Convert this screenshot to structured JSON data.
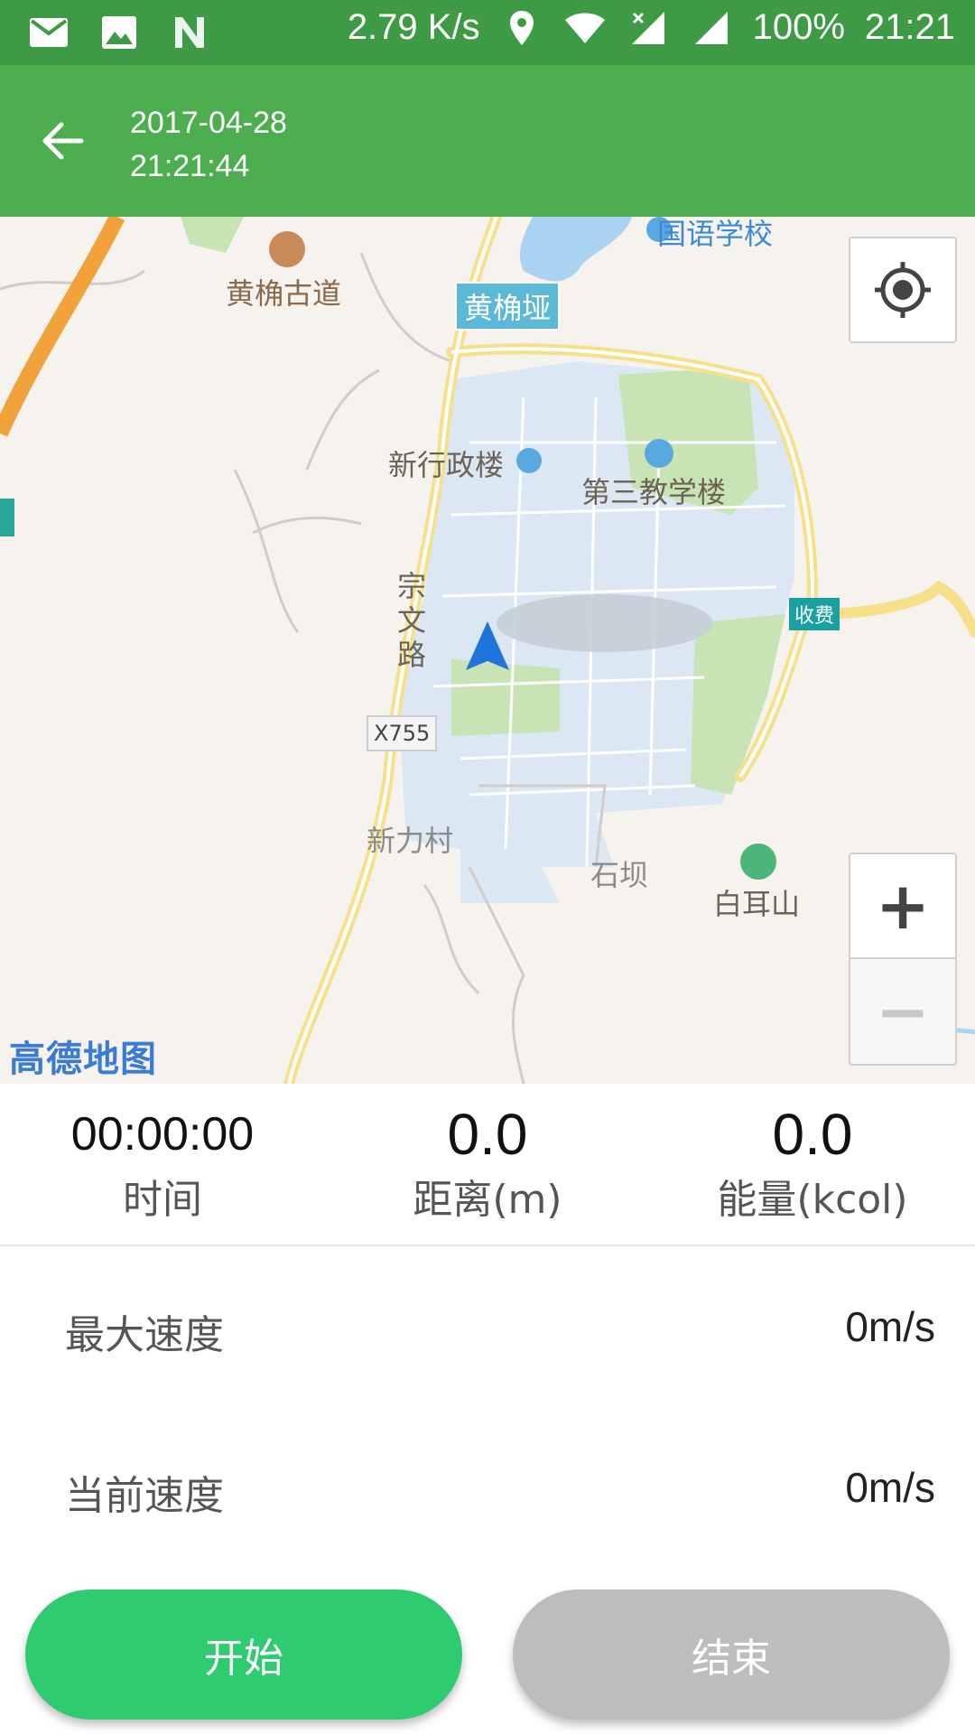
{
  "status_bar": {
    "net_speed": "2.79 K/s",
    "battery": "100%",
    "time": "21:21",
    "icons": [
      "mail-icon",
      "image-icon",
      "n-icon",
      "location-icon",
      "wifi-icon",
      "cellular-x-icon",
      "signal-icon"
    ]
  },
  "app_bar": {
    "date": "2017-04-28",
    "time": "21:21:44"
  },
  "map": {
    "labels": {
      "guoyu": "国语学校",
      "huangjiao_gudao": "黄桷古道",
      "huangjiaoya": "黄桷垭",
      "xinxingzheng": "新行政楼",
      "disan": "第三教学楼",
      "zongwen": "宗文路",
      "shoufei": "收费",
      "x755": "X755",
      "xinlicun": "新力村",
      "shiba": "石坝",
      "baier": "白耳山"
    },
    "logo": "高德地图",
    "zoom_in": "+",
    "zoom_out": "−"
  },
  "stats": {
    "time_value": "00:00:00",
    "time_label": "时间",
    "distance_value": "0.0",
    "distance_label": "距离(m)",
    "energy_value": "0.0",
    "energy_label": "能量(kcol)"
  },
  "max_speed": {
    "label": "最大速度",
    "value": "0m/s"
  },
  "current_speed": {
    "label": "当前速度",
    "value": "0m/s"
  },
  "buttons": {
    "start": "开始",
    "stop": "结束"
  },
  "colors": {
    "status_bar": "#3f9a45",
    "app_bar": "#4cae4f",
    "start": "#2ecb71",
    "stop": "#bdbdbd"
  }
}
